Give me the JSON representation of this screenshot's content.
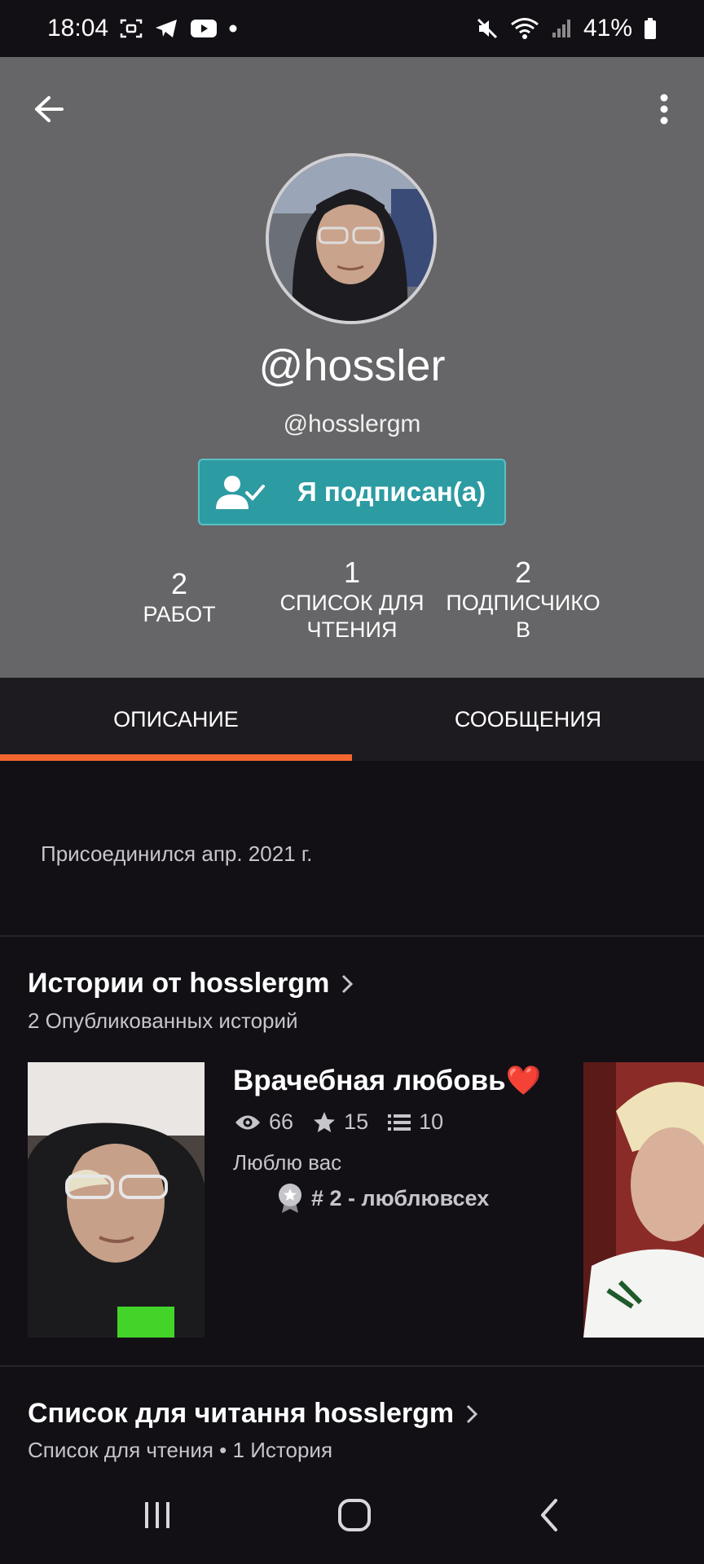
{
  "status_bar": {
    "time": "18:04",
    "battery": "41%",
    "left_icons": [
      "screen-record-icon",
      "telegram-icon",
      "youtube-icon",
      "dot-icon"
    ],
    "right_icons": [
      "mute-icon",
      "wifi-icon",
      "signal-icon",
      "battery-icon"
    ]
  },
  "profile": {
    "display_name": "@hossler",
    "username": "@hosslergm",
    "follow_label": "Я подписан(а)",
    "stats": [
      {
        "value": "2",
        "label": "РАБОТ"
      },
      {
        "value": "1",
        "label_line1": "СПИСОК ДЛЯ",
        "label_line2": "ЧТЕНИЯ"
      },
      {
        "value": "2",
        "label_line1": "ПОДПИСЧИКО",
        "label_line2": "В"
      }
    ]
  },
  "tabs": [
    {
      "label": "ОПИСАНИЕ",
      "active": true
    },
    {
      "label": "СООБЩЕНИЯ",
      "active": false
    }
  ],
  "about": {
    "joined": "Присоединился апр. 2021 г."
  },
  "stories_section": {
    "title": "Истории от hosslergm",
    "subtitle": "2 Опубликованных историй",
    "story": {
      "title": "Врачебная любовь❤️",
      "views": "66",
      "votes": "15",
      "parts": "10",
      "description": "Люблю вас",
      "rank": "# 2 - люблювсех"
    }
  },
  "reading_list_section": {
    "title": "Список для читання hosslergm",
    "subtitle": "Список для чтения • 1 История"
  },
  "colors": {
    "header_bg": "#666567",
    "follow_button": "#2c9ba2",
    "tab_indicator": "#f4672f",
    "page_bg": "#121015"
  }
}
